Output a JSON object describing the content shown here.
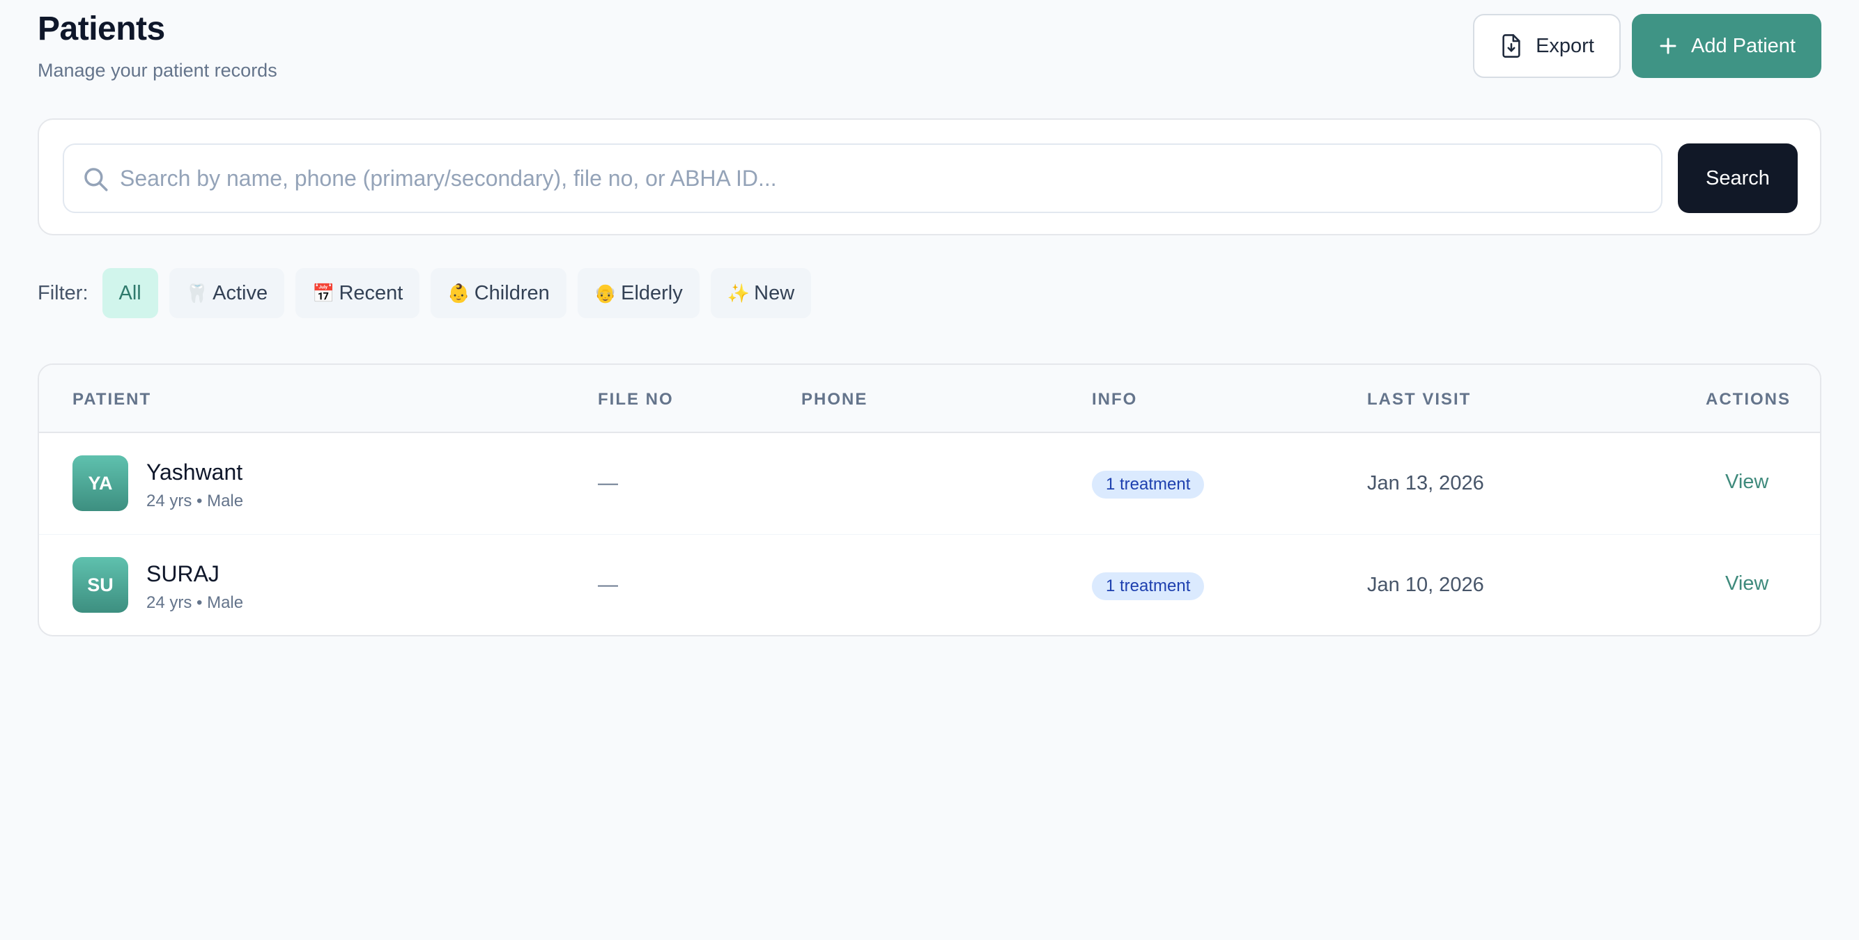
{
  "header": {
    "title": "Patients",
    "subtitle": "Manage your patient records",
    "export_label": "Export",
    "add_label": "Add Patient"
  },
  "search": {
    "placeholder": "Search by name, phone (primary/secondary), file no, or ABHA ID...",
    "value": "",
    "button_label": "Search"
  },
  "filters": {
    "label": "Filter:",
    "chips": [
      {
        "emoji": "",
        "label": "All",
        "active": true
      },
      {
        "emoji": "🦷",
        "label": "Active"
      },
      {
        "emoji": "📅",
        "label": "Recent"
      },
      {
        "emoji": "👶",
        "label": "Children"
      },
      {
        "emoji": "👴",
        "label": "Elderly"
      },
      {
        "emoji": "✨",
        "label": "New"
      }
    ]
  },
  "table": {
    "columns": [
      "PATIENT",
      "FILE NO",
      "PHONE",
      "INFO",
      "LAST VISIT",
      "ACTIONS"
    ],
    "rows": [
      {
        "initials": "YA",
        "name": "Yashwant",
        "meta": "24 yrs • Male",
        "file_no": "—",
        "phone": "",
        "info": "1 treatment",
        "last_visit": "Jan 13, 2026",
        "action": "View"
      },
      {
        "initials": "SU",
        "name": "SURAJ",
        "meta": "24 yrs • Male",
        "file_no": "—",
        "phone": "",
        "info": "1 treatment",
        "last_visit": "Jan 10, 2026",
        "action": "View"
      }
    ]
  },
  "colors": {
    "accent": "#3f9485",
    "search_button": "#111827",
    "active_chip_bg": "#d1f5ec",
    "badge_bg": "#dbeafe",
    "badge_text": "#1e40af"
  }
}
